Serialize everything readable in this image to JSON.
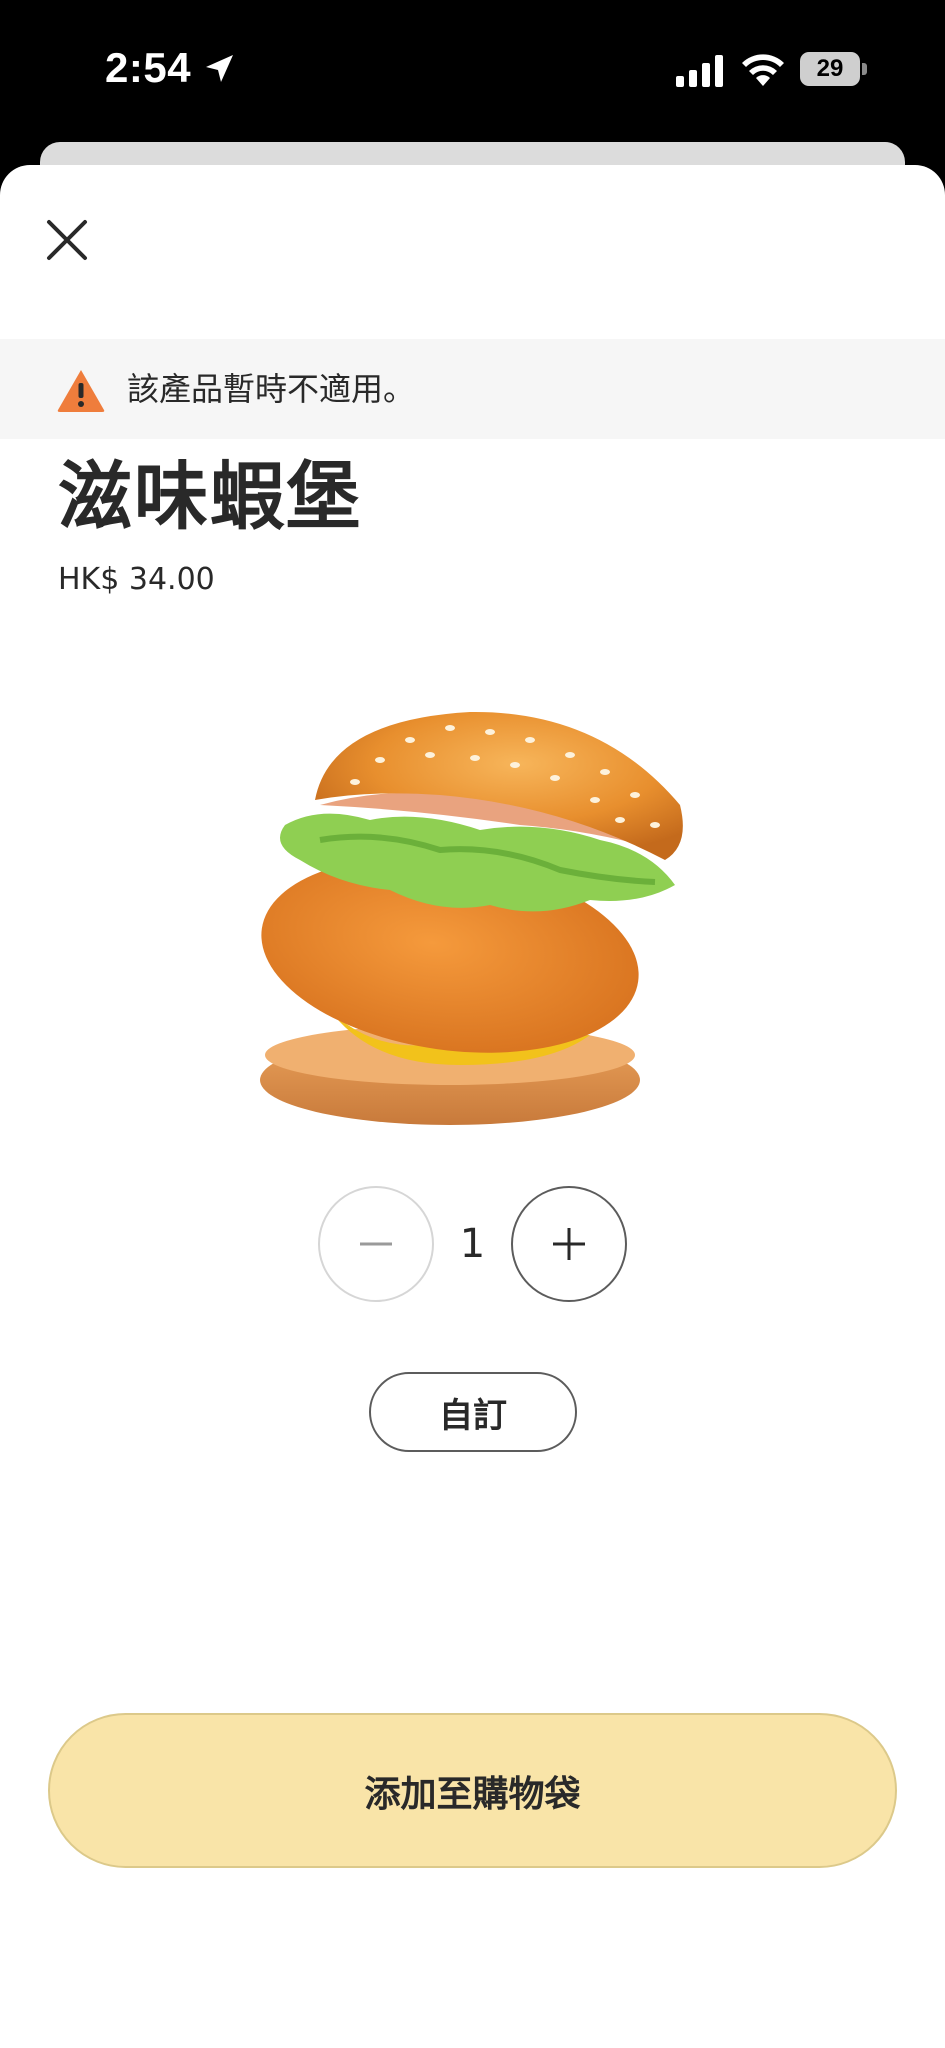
{
  "status_bar": {
    "time": "2:54",
    "battery": "29",
    "icons": [
      "location-arrow-icon",
      "cellular-signal-icon",
      "wifi-icon",
      "battery-icon"
    ]
  },
  "sheet": {
    "close_icon": "close-icon",
    "warning": {
      "icon": "warning-triangle-icon",
      "text": "該產品暫時不適用。",
      "icon_color": "#ef7d3c"
    },
    "product": {
      "name": "滋味蝦堡",
      "price": "HK$ 34.00",
      "image": "burger-image"
    },
    "quantity": {
      "value": "1",
      "minus_icon": "minus-icon",
      "plus_icon": "plus-icon"
    },
    "customize_label": "自訂",
    "add_to_bag_label": "添加至購物袋",
    "colors": {
      "primary_button": "#f9e4a8",
      "text": "#292929"
    }
  }
}
